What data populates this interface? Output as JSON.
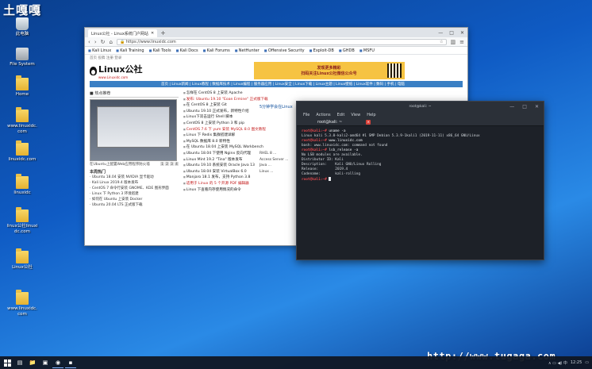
{
  "watermark_top": "土嘎嘎",
  "watermark_bottom": "http://www.tugaga.com",
  "desktop_icons": [
    {
      "label": "此电脑",
      "icon": "computer-icon"
    },
    {
      "label": "File System",
      "icon": "drive-icon"
    },
    {
      "label": "Home",
      "icon": "folder-icon"
    },
    {
      "label": "www.linuxidc.com",
      "icon": "folder-icon"
    },
    {
      "label": "linuxidc.com",
      "icon": "folder-icon"
    },
    {
      "label": "linuxidc",
      "icon": "folder-icon"
    },
    {
      "label": "linux公社linuxidc.com",
      "icon": "folder-icon"
    },
    {
      "label": "Linux公社",
      "icon": "folder-icon"
    },
    {
      "label": "www.linuxidc.com",
      "icon": "folder-icon"
    }
  ],
  "browser": {
    "tab_title": "Linux公社 - Linux系统门户网站",
    "new_tab": "+",
    "url": "https://www.linuxidc.com",
    "bookmarks": [
      "Kali Linux",
      "Kali Training",
      "Kali Tools",
      "Kali Docs",
      "Kali Forums",
      "NetHunter",
      "Offensive Security",
      "Exploit-DB",
      "GHDB",
      "MSFU"
    ],
    "site_top_links": "首页  投稿  注册  登录",
    "logo_text": "Linux公社",
    "logo_sub": "www.Linuxidc.com",
    "ad_line1": "发现更多精彩",
    "ad_line2": "扫码关注Linux公社微信公众号",
    "menu": "首页 | Linux新闻 | Linux教程 | 数据库技术 | Linux编程 | 服务器应用 | Linux安全 | Linux下载 | Linux主题 | Linux壁纸 | Linux软件 | 数码 | 手机 | 电脑",
    "section_title": "■ 热点推荐",
    "shot_caption": "在Ubuntu上配置Web应用程序防火墙",
    "pager": [
      "1",
      "2",
      "3",
      "4"
    ],
    "hot_title": "本周热门",
    "hot_list": [
      "· Ubuntu 18.04 安装 NVIDIA 显卡驱动",
      "· Kali Linux 2019.4 版本发布",
      "· CentOS 7 命令行安装 GNOME、KDE 图形界面",
      "· Linux 下 Python 3 环境搭建",
      "· 如何在 Ubuntu 上安装 Docker",
      "· Ubuntu 20.04 LTS 正式版下载"
    ],
    "news": [
      {
        "text": "怎样在 CentOS 8 上安装 Apache",
        "red": false
      },
      {
        "text": "发布: Ubuntu 19.10 \"Eoan Ermine\" 正式版下载",
        "red": true
      },
      {
        "text": "在 CentOS 8 上安装 Git",
        "red": false
      },
      {
        "text": "Ubuntu 19.10 正式发布，新特性介绍",
        "red": false
      },
      {
        "text": "Linux下双击运行 Shell 脚本",
        "red": false
      },
      {
        "text": "CentOS 8 上安装 Python 3 和 pip",
        "red": false
      },
      {
        "text": "CentOS 7.6 下 yum 安装 MySQL 8.0 图文教程",
        "red": true
      },
      {
        "text": "Linux 下 Redis 集群搭建详解",
        "red": false
      },
      {
        "text": "MySQL 数据库 8.0 新特性",
        "red": false
      },
      {
        "text": "在 Ubuntu 18.04 上安装 MySQL Workbench",
        "red": false
      },
      {
        "text": "Ubuntu 18.04 下使用 Nginx 反向代理",
        "red": false
      },
      {
        "text": "Linux Mint 19.2 \"Tina\" 版本发布",
        "red": false
      },
      {
        "text": "Ubuntu 19.10 系统安装 Oracle Java 13",
        "red": false
      },
      {
        "text": "Ubuntu 18.04 安装 VirtualBox 6.0",
        "red": false
      },
      {
        "text": "Manjaro 18.1 发布，支持 Python 3.8",
        "red": false
      },
      {
        "text": "适用于 Linux 的 5 个开源 PDF 编辑器",
        "red": true
      },
      {
        "text": "Linux 下查看内存使用情况的命令",
        "red": false
      }
    ],
    "right_title": "5分钟学会在Linux",
    "right_snips": [
      "RHEL 8 ...",
      "Access Server ...",
      "Java ...",
      "Linux ..."
    ]
  },
  "terminal": {
    "title": "root@kali: ~",
    "menu": [
      "File",
      "Actions",
      "Edit",
      "View",
      "Help"
    ],
    "tab_label": "root@kali: ~",
    "lines": [
      {
        "prompt": "root@kali:~#",
        "cmd": " uname -a"
      },
      {
        "out": "Linux kali 5.3.0-kali2-amd64 #1 SMP Debian 5.3.9-1kali1 (2019-11-11) x86_64 GNU/Linux"
      },
      {
        "prompt": "root@kali:~#",
        "cmd": " www.linuxidc.com"
      },
      {
        "out": "bash: www.linuxidc.com: command not found"
      },
      {
        "prompt": "root@kali:~#",
        "cmd": " lsb_release -a"
      },
      {
        "out": "No LSB modules are available."
      },
      {
        "out": "Distributor ID:\tKali"
      },
      {
        "out": "Description:\tKali GNU/Linux Rolling"
      },
      {
        "out": "Release:\t2019.4"
      },
      {
        "out": "Codename:\tkali-rolling"
      },
      {
        "prompt": "root@kali:~#",
        "cmd": " ",
        "cursor": true
      }
    ]
  },
  "taskbar": {
    "clock": "12:25",
    "tray_text": "∧  ▭  ◀)  中"
  },
  "colors": {
    "prompt": "#e0474c",
    "terminal_bg": "#1d2128",
    "accent_menu": "#3a7fc4"
  }
}
